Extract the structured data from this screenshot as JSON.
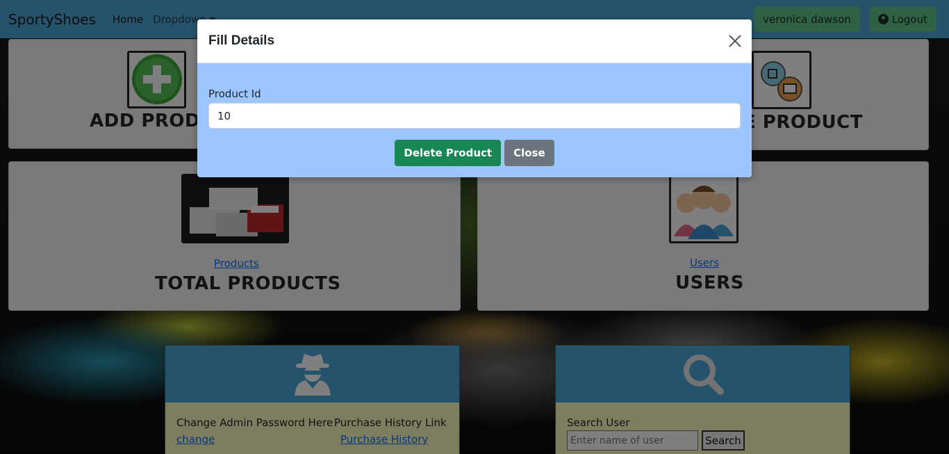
{
  "navbar": {
    "brand": "SportyShoes",
    "home": "Home",
    "dropdown": "Dropdown",
    "user_name": "veronica dawson",
    "logout": "Logout"
  },
  "cards": {
    "add_product_title": "ADD PRODUCT",
    "delete_product_title": "DELETE PRODUCT",
    "total_products_link": "Products",
    "total_products_title": "TOTAL PRODUCTS",
    "users_link": "Users",
    "users_title": "USERS"
  },
  "admin_panel": {
    "change_password_label": "Change Admin Password Here",
    "change_link": "change",
    "purchase_history_label": "Purchase History Link",
    "purchase_history_link": "Purchase History"
  },
  "search_panel": {
    "label": "Search User",
    "placeholder": "Enter name of user",
    "button": "Search"
  },
  "modal": {
    "title": "Fill Details",
    "field_label": "Product Id",
    "field_value": "10",
    "delete_button": "Delete Product",
    "close_button": "Close"
  },
  "colors": {
    "navbar": "#4aa6d6",
    "modal_body": "#9dc5ff",
    "delete_button": "#198754",
    "close_button": "#6c757d",
    "panel_body": "#fafabf"
  }
}
